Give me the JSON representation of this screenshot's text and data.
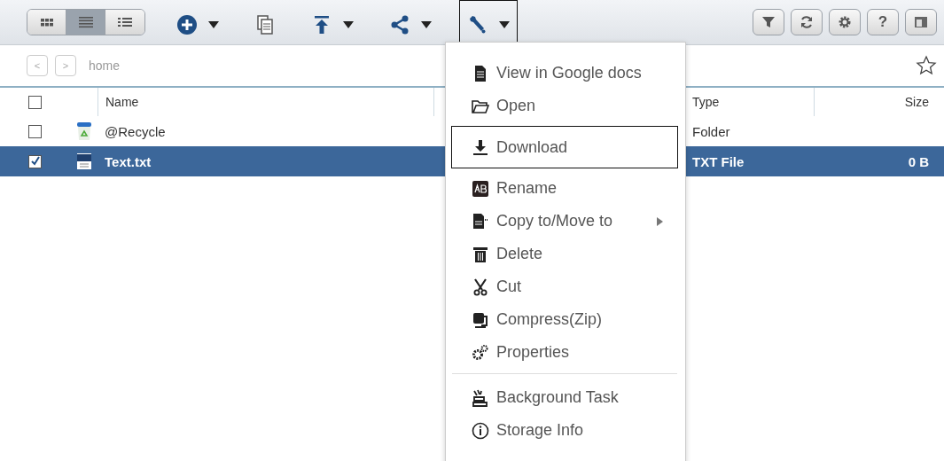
{
  "toolbar": {
    "view_modes": [
      {
        "kind": "grid",
        "selected": false
      },
      {
        "kind": "list",
        "selected": true
      },
      {
        "kind": "details",
        "selected": false
      }
    ],
    "actions": [
      {
        "kind": "add",
        "caret": true,
        "outlined": false
      },
      {
        "kind": "copy",
        "caret": false,
        "outlined": false
      },
      {
        "kind": "upload",
        "caret": true,
        "outlined": false
      },
      {
        "kind": "share",
        "caret": true,
        "outlined": false
      },
      {
        "kind": "tools",
        "caret": true,
        "outlined": true
      }
    ],
    "right_buttons": [
      {
        "kind": "filter"
      },
      {
        "kind": "refresh"
      },
      {
        "kind": "settings"
      },
      {
        "kind": "help",
        "text": "?"
      },
      {
        "kind": "panel"
      }
    ]
  },
  "path_bar": {
    "back": "<",
    "forward": ">",
    "path": "home",
    "favorite": false
  },
  "table": {
    "columns": [
      {
        "kind": "check",
        "checked": false
      },
      {
        "kind": "icon"
      },
      {
        "kind": "name",
        "label": "Name"
      },
      {
        "kind": "modified"
      },
      {
        "kind": "type",
        "label": "Type"
      },
      {
        "kind": "size",
        "label": "Size"
      }
    ],
    "rows": [
      {
        "selected": false,
        "checked": false,
        "kind": "recycle",
        "name": "@Recycle",
        "type": "Folder",
        "size": ""
      },
      {
        "selected": true,
        "checked": true,
        "kind": "txt",
        "name": "Text.txt",
        "type": "TXT File",
        "size": "0 B"
      }
    ]
  },
  "menu": {
    "items": [
      {
        "kind": "doc",
        "label": "View in Google docs",
        "submenu": false,
        "outlined": false,
        "separator_before": false
      },
      {
        "kind": "folder",
        "label": "Open",
        "submenu": false,
        "outlined": false,
        "separator_before": false
      },
      {
        "kind": "download",
        "label": "Download",
        "submenu": false,
        "outlined": true,
        "separator_before": false
      },
      {
        "kind": "rename",
        "label": "Rename",
        "submenu": false,
        "outlined": false,
        "separator_before": false
      },
      {
        "kind": "copymove",
        "label": "Copy to/Move to",
        "submenu": true,
        "outlined": false,
        "separator_before": false
      },
      {
        "kind": "delete",
        "label": "Delete",
        "submenu": false,
        "outlined": false,
        "separator_before": false
      },
      {
        "kind": "cut",
        "label": "Cut",
        "submenu": false,
        "outlined": false,
        "separator_before": false
      },
      {
        "kind": "compress",
        "label": "Compress(Zip)",
        "submenu": false,
        "outlined": false,
        "separator_before": false
      },
      {
        "kind": "properties",
        "label": "Properties",
        "submenu": false,
        "outlined": false,
        "separator_before": false
      },
      {
        "kind": "task",
        "label": "Background Task",
        "submenu": false,
        "outlined": false,
        "separator_before": true
      },
      {
        "kind": "info",
        "label": "Storage Info",
        "submenu": false,
        "outlined": false,
        "separator_before": false
      }
    ]
  }
}
